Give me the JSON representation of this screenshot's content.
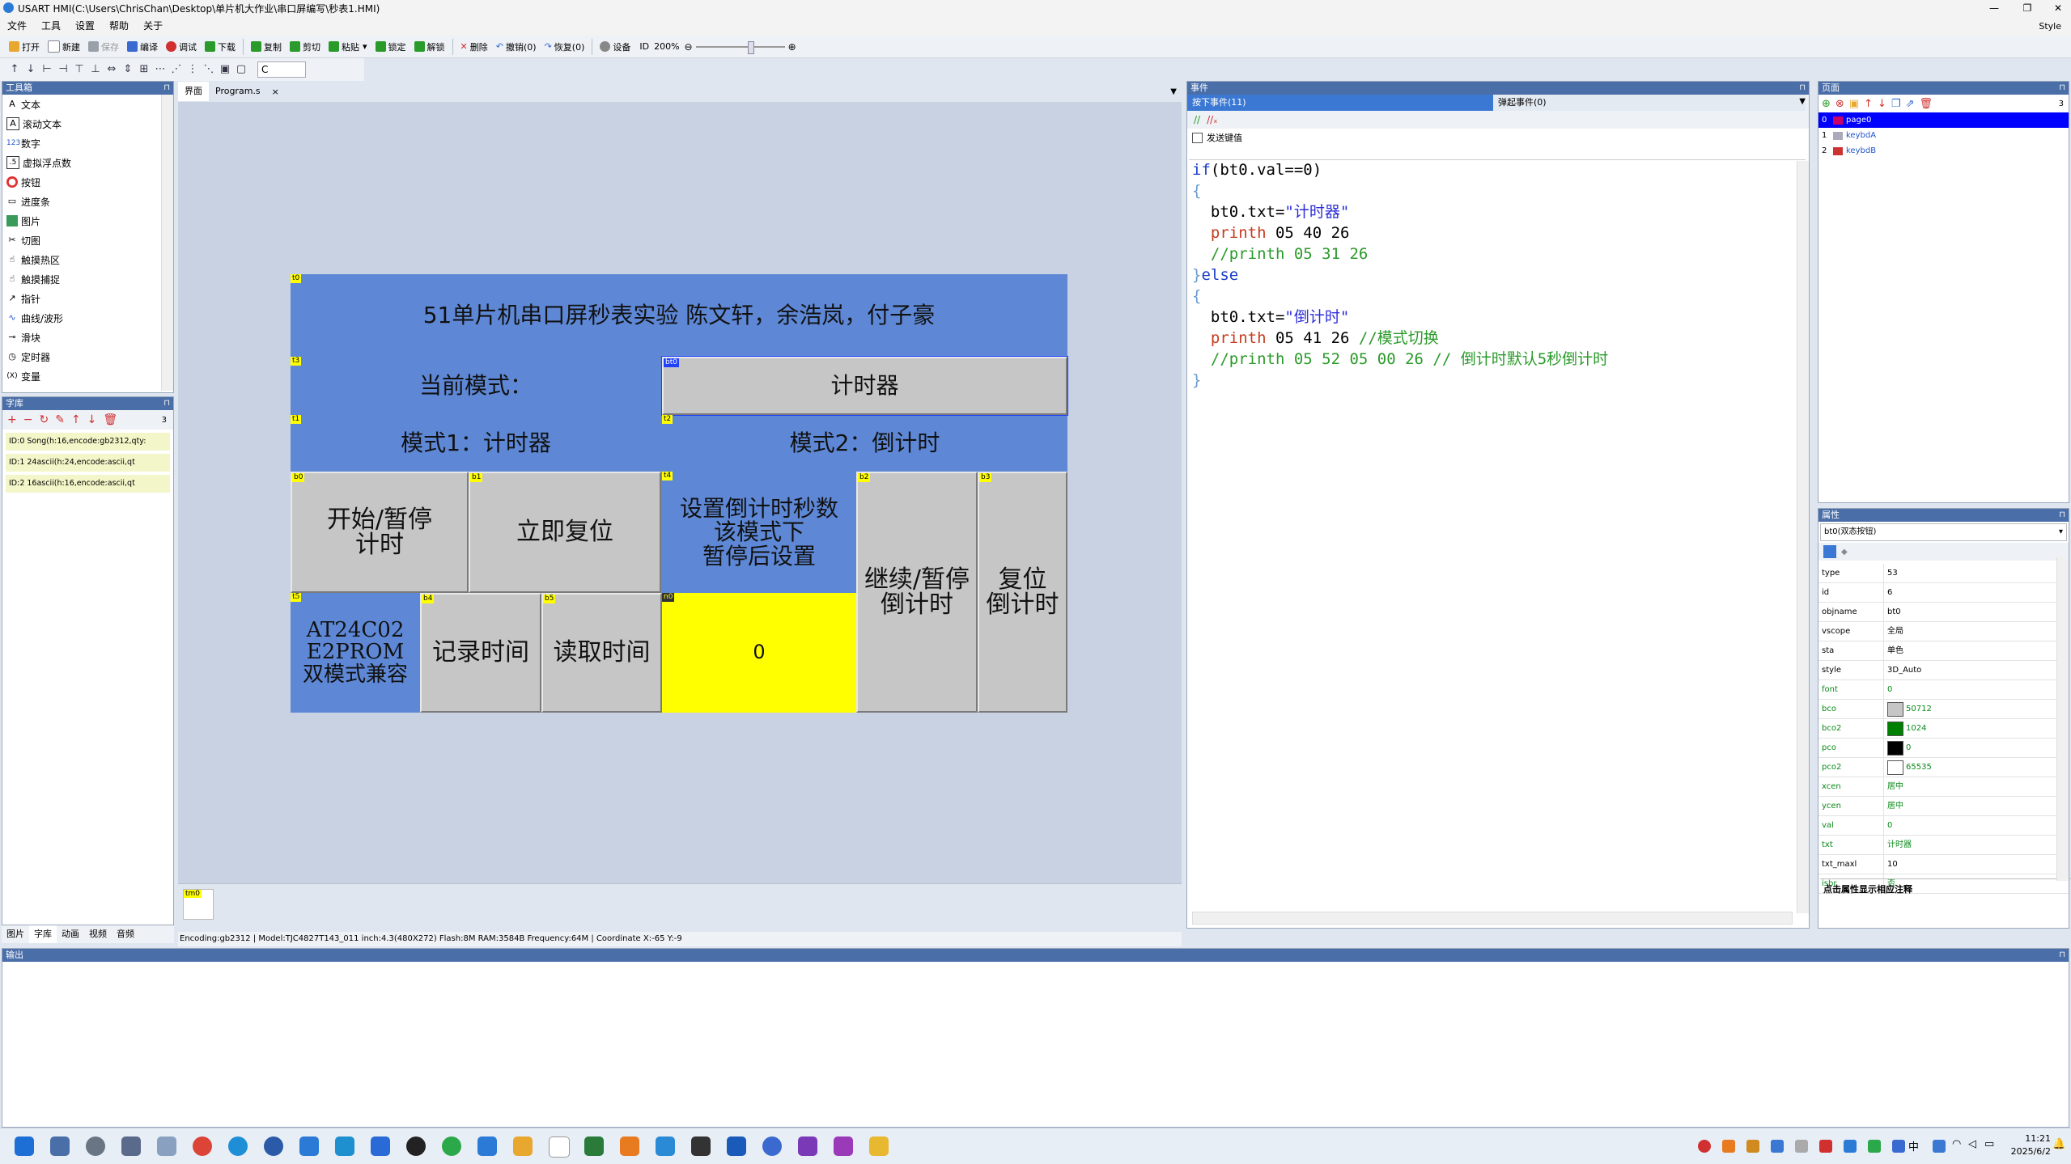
{
  "window": {
    "title": "USART HMI(C:\\Users\\ChrisChan\\Desktop\\单片机大作业\\串口屏编写\\秒表1.HMI)",
    "style_label": "Style"
  },
  "menu": [
    "文件",
    "工具",
    "设置",
    "帮助",
    "关于"
  ],
  "toolbar": [
    {
      "label": "打开",
      "color": "#e8a830"
    },
    {
      "label": "新建",
      "color": "#ffffff"
    },
    {
      "label": "保存",
      "color": "#9aa0a8"
    },
    {
      "label": "编译",
      "color": "#3a6ad0"
    },
    {
      "label": "调试",
      "color": "#d03030"
    },
    {
      "label": "下载",
      "color": "#2a9a2a"
    },
    {
      "label": "复制",
      "color": "#2a9a2a"
    },
    {
      "label": "剪切",
      "color": "#2a9a2a"
    },
    {
      "label": "粘贴",
      "color": "#2a9a2a"
    },
    {
      "label": "锁定",
      "color": "#2a9a2a"
    },
    {
      "label": "解锁",
      "color": "#2a9a2a"
    },
    {
      "label": "删除",
      "color": "#d03030"
    },
    {
      "label": "撤销(0)",
      "color": "#3a6ad0"
    },
    {
      "label": "恢复(0)",
      "color": "#3a6ad0"
    },
    {
      "label": "设备",
      "color": "#888888"
    }
  ],
  "zoom": {
    "id_label": "ID",
    "value": "200%"
  },
  "toolbox": {
    "title": "工具箱",
    "items": [
      "文本",
      "滚动文本",
      "数字",
      "虚拟浮点数",
      "按钮",
      "进度条",
      "图片",
      "切图",
      "触摸热区",
      "触摸捕捉",
      "指针",
      "曲线/波形",
      "滑块",
      "定时器",
      "变量"
    ]
  },
  "fontlib": {
    "title": "字库",
    "count": "3",
    "rows": [
      "ID:0  Song(h:16,encode:gb2312,qty:",
      "ID:1  24ascii(h:24,encode:ascii,qt",
      "ID:2  16ascii(h:16,encode:ascii,qt"
    ]
  },
  "left_tabs": [
    {
      "label": "图片",
      "selected": false
    },
    {
      "label": "字库",
      "selected": true
    },
    {
      "label": "动画",
      "selected": false
    },
    {
      "label": "视频",
      "selected": false
    },
    {
      "label": "音频",
      "selected": false
    }
  ],
  "doc_tabs": [
    {
      "label": "界面",
      "selected": true
    },
    {
      "label": "Program.s",
      "selected": false
    }
  ],
  "doc_close": "×",
  "hmi": {
    "t0": {
      "tag": "t0",
      "text": "51单片机串口屏秒表实验 陈文轩，余浩岚，付子豪"
    },
    "t3": {
      "tag": "t3",
      "text": "当前模式："
    },
    "bt0": {
      "tag": "bt0",
      "text": "计时器"
    },
    "t1": {
      "tag": "t1",
      "text": "模式1：计时器"
    },
    "t2": {
      "tag": "t2",
      "text": "模式2：倒计时"
    },
    "b0": {
      "tag": "b0",
      "text": "开始/暂停\n计时"
    },
    "b1": {
      "tag": "b1",
      "text": "立即复位"
    },
    "t4": {
      "tag": "t4",
      "text": "设置倒计时秒数\n该模式下\n暂停后设置"
    },
    "b2": {
      "tag": "b2",
      "text": "继续/暂停\n倒计时"
    },
    "b3": {
      "tag": "b3",
      "text": "复位\n倒计时"
    },
    "t5": {
      "tag": "t5",
      "text": "AT24C02\nE2PROM\n双模式兼容"
    },
    "b4": {
      "tag": "b4",
      "text": "记录时间"
    },
    "b5": {
      "tag": "b5",
      "text": "读取时间"
    },
    "n0": {
      "tag": "n0",
      "text": "0"
    }
  },
  "timer_tag": "tm0",
  "statusbar": "Encoding:gb2312  |  Model:TJC4827T143_011   inch:4.3(480X272) Flash:8M RAM:3584B Frequency:64M    |  Coordinate X:-65  Y:-9",
  "events": {
    "title": "事件",
    "tab_press": "按下事件(11)",
    "tab_release": "弹起事件(0)",
    "send_key": "发送键值",
    "code_lines": [
      [
        {
          "t": "if",
          "c": "kw"
        },
        {
          "t": "(bt0.val==0)",
          "c": ""
        }
      ],
      [
        {
          "t": "{",
          "c": "br"
        }
      ],
      [
        {
          "t": "  bt0.txt=",
          "c": ""
        },
        {
          "t": "\"计时器\"",
          "c": "str"
        }
      ],
      [
        {
          "t": "  printh",
          "c": "fn"
        },
        {
          "t": " 05 40 26",
          "c": ""
        }
      ],
      [
        {
          "t": "  //printh 05 31 26",
          "c": "cm"
        }
      ],
      [
        {
          "t": "}",
          "c": "br"
        },
        {
          "t": "else",
          "c": "kw"
        }
      ],
      [
        {
          "t": "{",
          "c": "br"
        }
      ],
      [
        {
          "t": "  bt0.txt=",
          "c": ""
        },
        {
          "t": "\"倒计时\"",
          "c": "str"
        }
      ],
      [
        {
          "t": "  printh",
          "c": "fn"
        },
        {
          "t": " 05 41 26 ",
          "c": ""
        },
        {
          "t": "//模式切换",
          "c": "cm"
        }
      ],
      [
        {
          "t": "  //printh 05 52 05 00 26 // 倒计时默认5秒倒计时",
          "c": "cm"
        }
      ],
      [
        {
          "t": "}",
          "c": "br"
        }
      ]
    ]
  },
  "pages": {
    "title": "页面",
    "count": "3",
    "items": [
      {
        "index": "0",
        "name": "page0",
        "selected": true
      },
      {
        "index": "1",
        "name": "keybdA",
        "selected": false
      },
      {
        "index": "2",
        "name": "keybdB",
        "selected": false
      }
    ]
  },
  "attributes": {
    "title": "属性",
    "object": "bt0(双态按钮)",
    "rows": [
      {
        "k": "type",
        "v": "53",
        "green": false
      },
      {
        "k": "id",
        "v": "6",
        "green": false
      },
      {
        "k": "objname",
        "v": "bt0",
        "green": false
      },
      {
        "k": "vscope",
        "v": "全局",
        "green": false
      },
      {
        "k": "sta",
        "v": "单色",
        "green": false
      },
      {
        "k": "style",
        "v": "3D_Auto",
        "green": false
      },
      {
        "k": "font",
        "v": "0",
        "green": true
      },
      {
        "k": "bco",
        "v": "50712",
        "green": true,
        "swatch": "#c6c6c6"
      },
      {
        "k": "bco2",
        "v": "1024",
        "green": true,
        "swatch": "#008000"
      },
      {
        "k": "pco",
        "v": "0",
        "green": true,
        "swatch": "#000000"
      },
      {
        "k": "pco2",
        "v": "65535",
        "green": true,
        "swatch": "#ffffff"
      },
      {
        "k": "xcen",
        "v": "居中",
        "green": true
      },
      {
        "k": "ycen",
        "v": "居中",
        "green": true
      },
      {
        "k": "val",
        "v": "0",
        "green": true
      },
      {
        "k": "txt",
        "v": "计时器",
        "green": true
      },
      {
        "k": "txt_maxl",
        "v": "10",
        "green": false
      },
      {
        "k": "isbr",
        "v": "否",
        "green": true
      }
    ],
    "hint": "点击属性显示相应注释"
  },
  "output": {
    "title": "输出"
  },
  "clock": {
    "time": "11:21",
    "date": "2025/6/2"
  },
  "ime": "中"
}
